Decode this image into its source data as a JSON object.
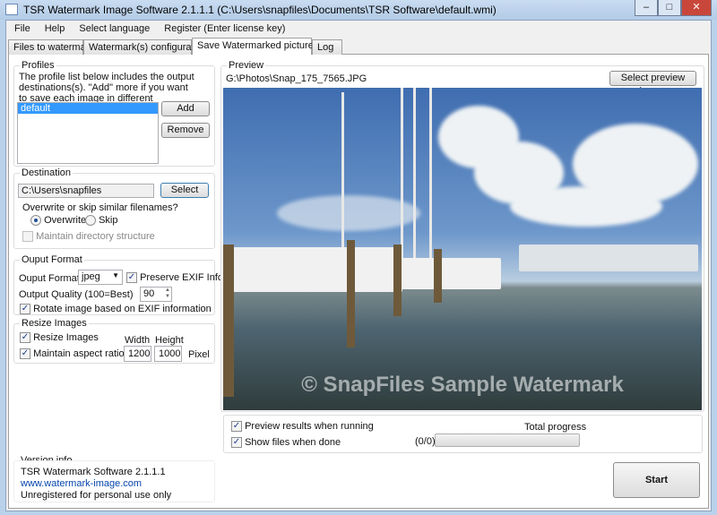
{
  "window": {
    "title": "TSR Watermark Image Software 2.1.1.1 (C:\\Users\\snapfiles\\Documents\\TSR Software\\default.wmi)",
    "min": "–",
    "max": "□",
    "close": "✕"
  },
  "menu": [
    "File",
    "Help",
    "Select language",
    "Register (Enter license key)"
  ],
  "tabs": [
    "Files to watermark",
    "Watermark(s) configuration",
    "Save Watermarked pictures as",
    "Log"
  ],
  "profiles": {
    "label": "Profiles",
    "description": "The profile list below includes the output destinations(s). \"Add\" more if you want to save each image in different sizes/formats/etc..",
    "items": [
      "default"
    ],
    "add": "Add",
    "remove": "Remove"
  },
  "destination": {
    "label": "Destination",
    "path": "C:\\Users\\snapfiles",
    "select": "Select",
    "question": "Overwrite or skip similar filenames?",
    "overwrite": "Overwrite",
    "skip": "Skip",
    "overwrite_selected": true,
    "maintain": "Maintain directory structure"
  },
  "output": {
    "label": "Ouput Format",
    "format_label": "Ouput Format",
    "format": "jpeg",
    "preserve_exif": "Preserve EXIF Info",
    "quality_label": "Output Quality (100=Best)",
    "quality": "90",
    "rotate": "Rotate image based on EXIF information"
  },
  "resize": {
    "label": "Resize Images",
    "resize": "Resize Images",
    "aspect": "Maintain aspect ratio",
    "width_label": "Width",
    "height_label": "Height",
    "width": "1200",
    "height": "1000",
    "unit": "Pixel"
  },
  "version": {
    "label": "Version info",
    "name": "TSR Watermark Software 2.1.1.1",
    "link": "www.watermark-image.com",
    "status": "Unregistered for personal use only"
  },
  "preview": {
    "label": "Preview",
    "file": "G:\\Photos\\Snap_175_7565.JPG",
    "select": "Select preview image",
    "watermark": "© SnapFiles Sample Watermark"
  },
  "run": {
    "preview_results": "Preview results when running",
    "show_files": "Show files when done",
    "total_label": "Total progress",
    "count": "(0/0)",
    "progress": 0,
    "start": "Start"
  }
}
